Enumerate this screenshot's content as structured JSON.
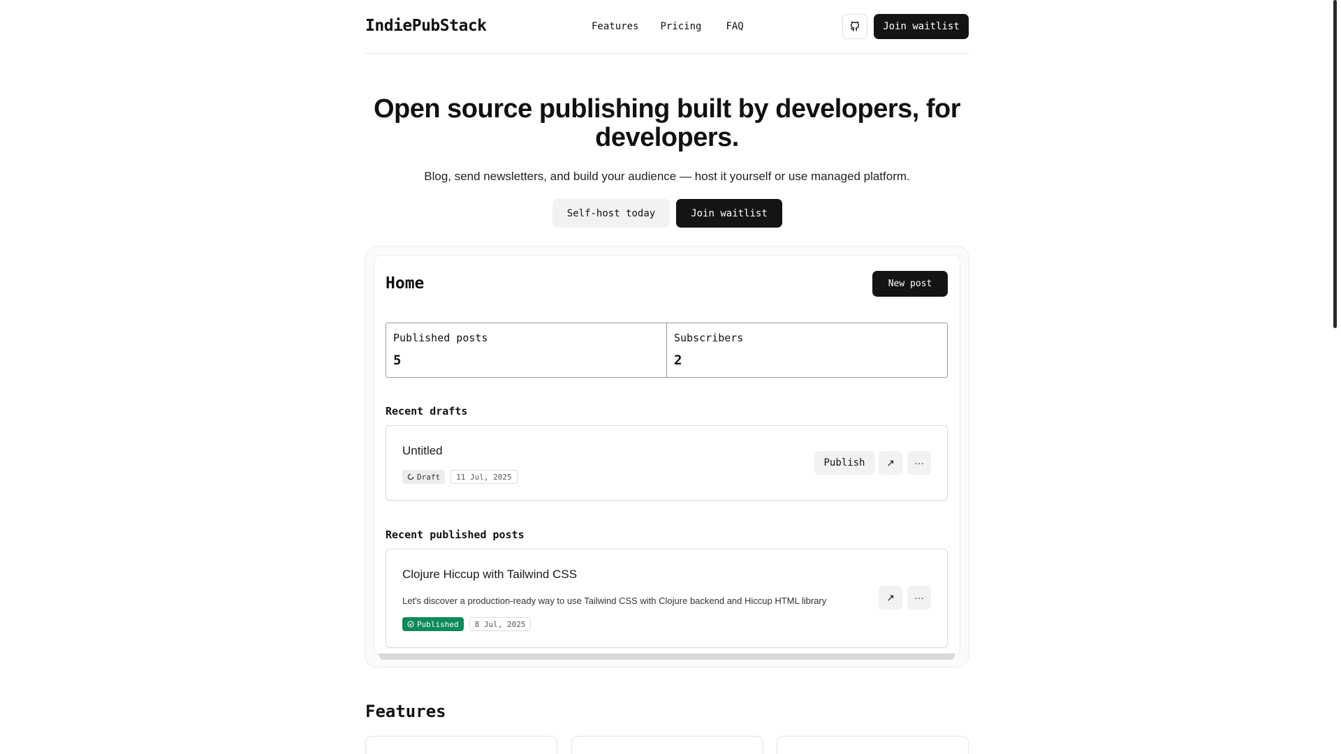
{
  "header": {
    "brand": "IndiePubStack",
    "nav": [
      "Features",
      "Pricing",
      "FAQ"
    ],
    "github_icon": "github-icon",
    "join_label": "Join waitlist"
  },
  "hero": {
    "title": "Open source publishing built by developers, for developers.",
    "subtitle": "Blog, send newsletters, and build your audience — host it yourself or use managed platform.",
    "selfhost_label": "Self-host today",
    "join_label": "Join waitlist"
  },
  "preview": {
    "title": "Home",
    "new_post_label": "New post",
    "stats": [
      {
        "label": "Published posts",
        "value": "5"
      },
      {
        "label": "Subscribers",
        "value": "2"
      }
    ],
    "drafts_heading": "Recent drafts",
    "draft": {
      "title": "Untitled",
      "status": "Draft",
      "date": "11 Jul, 2025",
      "publish_label": "Publish",
      "open_icon": "↗",
      "more_icon": "···"
    },
    "published_heading": "Recent published posts",
    "post": {
      "title": "Clojure Hiccup with Tailwind CSS",
      "description": "Let's discover a production-ready way to use Tailwind CSS with Clojure backend and Hiccup HTML library",
      "status": "Published",
      "date": "8 Jul, 2025",
      "open_icon": "↗",
      "more_icon": "···"
    }
  },
  "features": {
    "title": "Features"
  },
  "colors": {
    "dark": "#141414",
    "published_green": "#0d8a5b",
    "light_button": "#f2f2f2"
  }
}
